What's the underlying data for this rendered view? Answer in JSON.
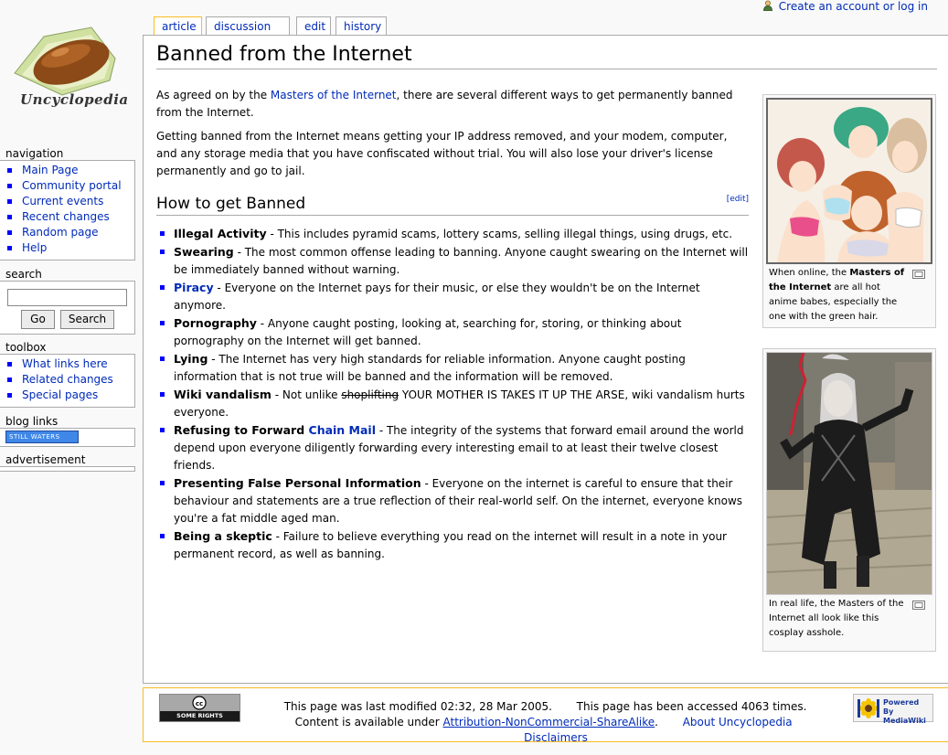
{
  "personal": {
    "create_account": "Create an account or log in"
  },
  "logo": {
    "wordmark": "Uncyclopedia"
  },
  "tabs": [
    {
      "label": "article",
      "selected": true
    },
    {
      "label": "discussion",
      "selected": false
    },
    {
      "label": "edit",
      "selected": false
    },
    {
      "label": "history",
      "selected": false
    }
  ],
  "sidebar": {
    "navigation": {
      "title": "navigation",
      "items": [
        "Main Page",
        "Community portal",
        "Current events",
        "Recent changes",
        "Random page",
        "Help"
      ]
    },
    "search": {
      "title": "search",
      "value": "",
      "go_label": "Go",
      "search_label": "Search"
    },
    "toolbox": {
      "title": "toolbox",
      "items": [
        "What links here",
        "Related changes",
        "Special pages"
      ]
    },
    "bloglinks": {
      "title": "blog links",
      "badge_text": "STILL WATERS"
    },
    "advertisement": {
      "title": "advertisement"
    }
  },
  "article": {
    "title": "Banned from the Internet",
    "intro1": {
      "before": "As agreed on by the ",
      "link": "Masters of the Internet",
      "after": ", there are several different ways to get permanently banned from the Internet."
    },
    "intro2": "Getting banned from the Internet means getting your IP address removed, and your modem, computer, and any storage media that you have confiscated without trial. You will also lose your driver's license permanently and go to jail.",
    "section": {
      "title": "How to get Banned",
      "edit_label": "[edit]"
    },
    "items": {
      "illegal": {
        "term": "Illegal Activity",
        "text": " - This includes pyramid scams, lottery scams, selling illegal things, using drugs, etc."
      },
      "swearing": {
        "term": "Swearing",
        "text": " - The most common offense leading to banning. Anyone caught swearing on the Internet will be immediately banned without warning."
      },
      "piracy": {
        "term": "Piracy",
        "text": " - Everyone on the Internet pays for their music, or else they wouldn't be on the Internet anymore."
      },
      "porn": {
        "term": "Pornography",
        "text": " - Anyone caught posting, looking at, searching for, storing, or thinking about pornography on the Internet will get banned."
      },
      "lying": {
        "term": "Lying",
        "text": " - The Internet has very high standards for reliable information. Anyone caught posting information that is not true will be banned and the information will be removed."
      },
      "wiki": {
        "term": "Wiki vandalism",
        "before": " - Not unlike ",
        "struck": "shoplifting",
        "after": " YOUR MOTHER IS TAKES IT UP THE ARSE, wiki vandalism hurts everyone."
      },
      "chain": {
        "term": "Refusing to Forward ",
        "link": "Chain Mail",
        "text": " - The integrity of the systems that forward email around the world depend upon everyone diligently forwarding every interesting email to at least their twelve closest friends."
      },
      "false": {
        "term": "Presenting False Personal Information",
        "text": " - Everyone on the internet is careful to ensure that their behaviour and statements are a true reflection of their real-world self. On the internet, everyone knows you're a fat middle aged man."
      },
      "skeptic": {
        "term": "Being a skeptic",
        "text": " - Failure to believe everything you read on the internet will result in a note in your permanent record, as well as banning."
      }
    },
    "thumb1": {
      "before": "When online, the ",
      "bold": "Masters of the Internet",
      "after": " are all hot anime babes, especially the one with the green hair."
    },
    "thumb2": {
      "caption": "In real life, the Masters of the Internet all look like this cosplay asshole."
    }
  },
  "footer": {
    "cc_badge": "SOME RIGHTS RESERVED",
    "modified": "This page was last modified 02:32, 28 Mar 2005.",
    "accessed": "This page has been accessed 4063 times.",
    "content_is": "Content is",
    "available": "available under ",
    "license": "Attribution-NonCommercial-ShareAlike",
    "about": "About Uncyclopedia",
    "disclaimers": "Disclaimers",
    "mw_badge": "Powered By MediaWiki"
  },
  "colors": {
    "link": "#002bb8",
    "tab_selected_border": "#fabd23",
    "bullet": "#0000ff"
  }
}
